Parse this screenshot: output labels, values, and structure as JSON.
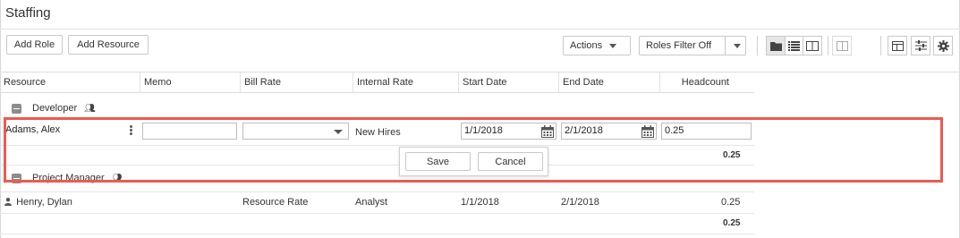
{
  "title": "Staffing",
  "toolbar": {
    "add_role": "Add Role",
    "add_resource": "Add Resource",
    "actions": "Actions",
    "roles_filter": "Roles Filter Off"
  },
  "icons": [
    "folder-icon",
    "list-icon",
    "split-view-icon",
    "panel-icon",
    "caret-down-icon",
    "layout-icon",
    "sliders-icon",
    "gear-icon"
  ],
  "columns": [
    "Resource",
    "Memo",
    "Bill Rate",
    "Internal Rate",
    "Start Date",
    "End Date",
    "Headcount"
  ],
  "groups": [
    {
      "label": "Developer",
      "edit_row": {
        "resource": "Adams, Alex",
        "memo": "",
        "bill_rate": "",
        "internal_rate": "New Hires",
        "start_date": "1/1/2018",
        "end_date": "2/1/2018",
        "headcount": "0.25"
      },
      "subtotal": "0.25"
    },
    {
      "label": "Project Manager",
      "row": {
        "resource": "Henry, Dylan",
        "bill_rate": "Resource Rate",
        "internal_rate": "Analyst",
        "start_date": "1/1/2018",
        "end_date": "2/1/2018",
        "headcount": "0.25"
      },
      "subtotal": "0.25"
    }
  ],
  "popup": {
    "save": "Save",
    "cancel": "Cancel"
  },
  "colors": {
    "highlight": "#ee5a4f"
  }
}
